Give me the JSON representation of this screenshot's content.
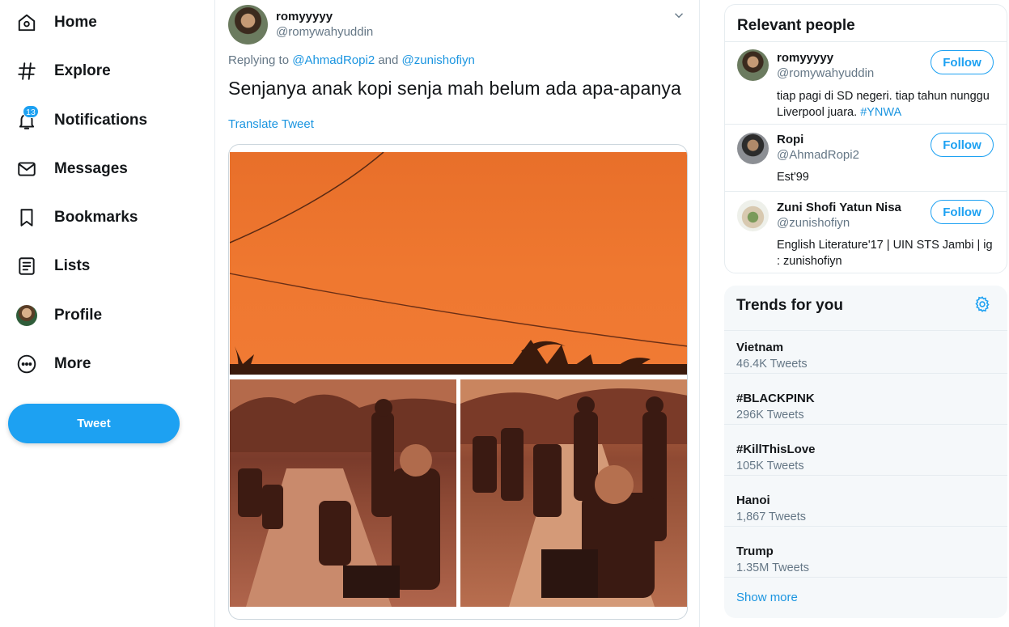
{
  "nav": {
    "items": [
      {
        "label": "Home",
        "icon": "home-icon"
      },
      {
        "label": "Explore",
        "icon": "hashtag-icon"
      },
      {
        "label": "Notifications",
        "icon": "bell-icon",
        "badge": "13"
      },
      {
        "label": "Messages",
        "icon": "envelope-icon"
      },
      {
        "label": "Bookmarks",
        "icon": "bookmark-icon"
      },
      {
        "label": "Lists",
        "icon": "list-icon"
      },
      {
        "label": "Profile",
        "icon": "avatar"
      },
      {
        "label": "More",
        "icon": "more-icon"
      }
    ],
    "tweet_button": "Tweet"
  },
  "tweet": {
    "author_name": "romyyyyy",
    "author_handle": "@romywahyuddin",
    "replying_prefix": "Replying to",
    "replying_to": [
      "@AhmadRopi2",
      "@zunishofiyn"
    ],
    "replying_joiner": "and",
    "text": "Senjanya anak kopi senja mah belum ada apa-apanya",
    "translate": "Translate Tweet"
  },
  "relevant_people": {
    "title": "Relevant people",
    "follow_label": "Follow",
    "people": [
      {
        "name": "romyyyyy",
        "handle": "@romywahyuddin",
        "bio": "tiap pagi di SD negeri. tiap tahun nunggu Liverpool juara.",
        "bio_tag": "#YNWA"
      },
      {
        "name": "Ropi",
        "handle": "@AhmadRopi2",
        "bio": "Est'99"
      },
      {
        "name": "Zuni Shofi Yatun Nisa",
        "handle": "@zunishofiyn",
        "bio": "English Literature'17 | UIN STS Jambi | ig : zunishofiyn"
      }
    ]
  },
  "trends": {
    "title": "Trends for you",
    "items": [
      {
        "name": "Vietnam",
        "count": "46.4K Tweets"
      },
      {
        "name": "#BLACKPINK",
        "count": "296K Tweets"
      },
      {
        "name": "#KillThisLove",
        "count": "105K Tweets"
      },
      {
        "name": "Hanoi",
        "count": "1,867 Tweets"
      },
      {
        "name": "Trump",
        "count": "1.35M Tweets"
      }
    ],
    "show_more": "Show more"
  },
  "colors": {
    "accent": "#1da1f2",
    "link": "#1b95e0",
    "secondary_text": "#657786",
    "border": "#e6ecf0",
    "trends_bg": "#f5f8fa"
  }
}
